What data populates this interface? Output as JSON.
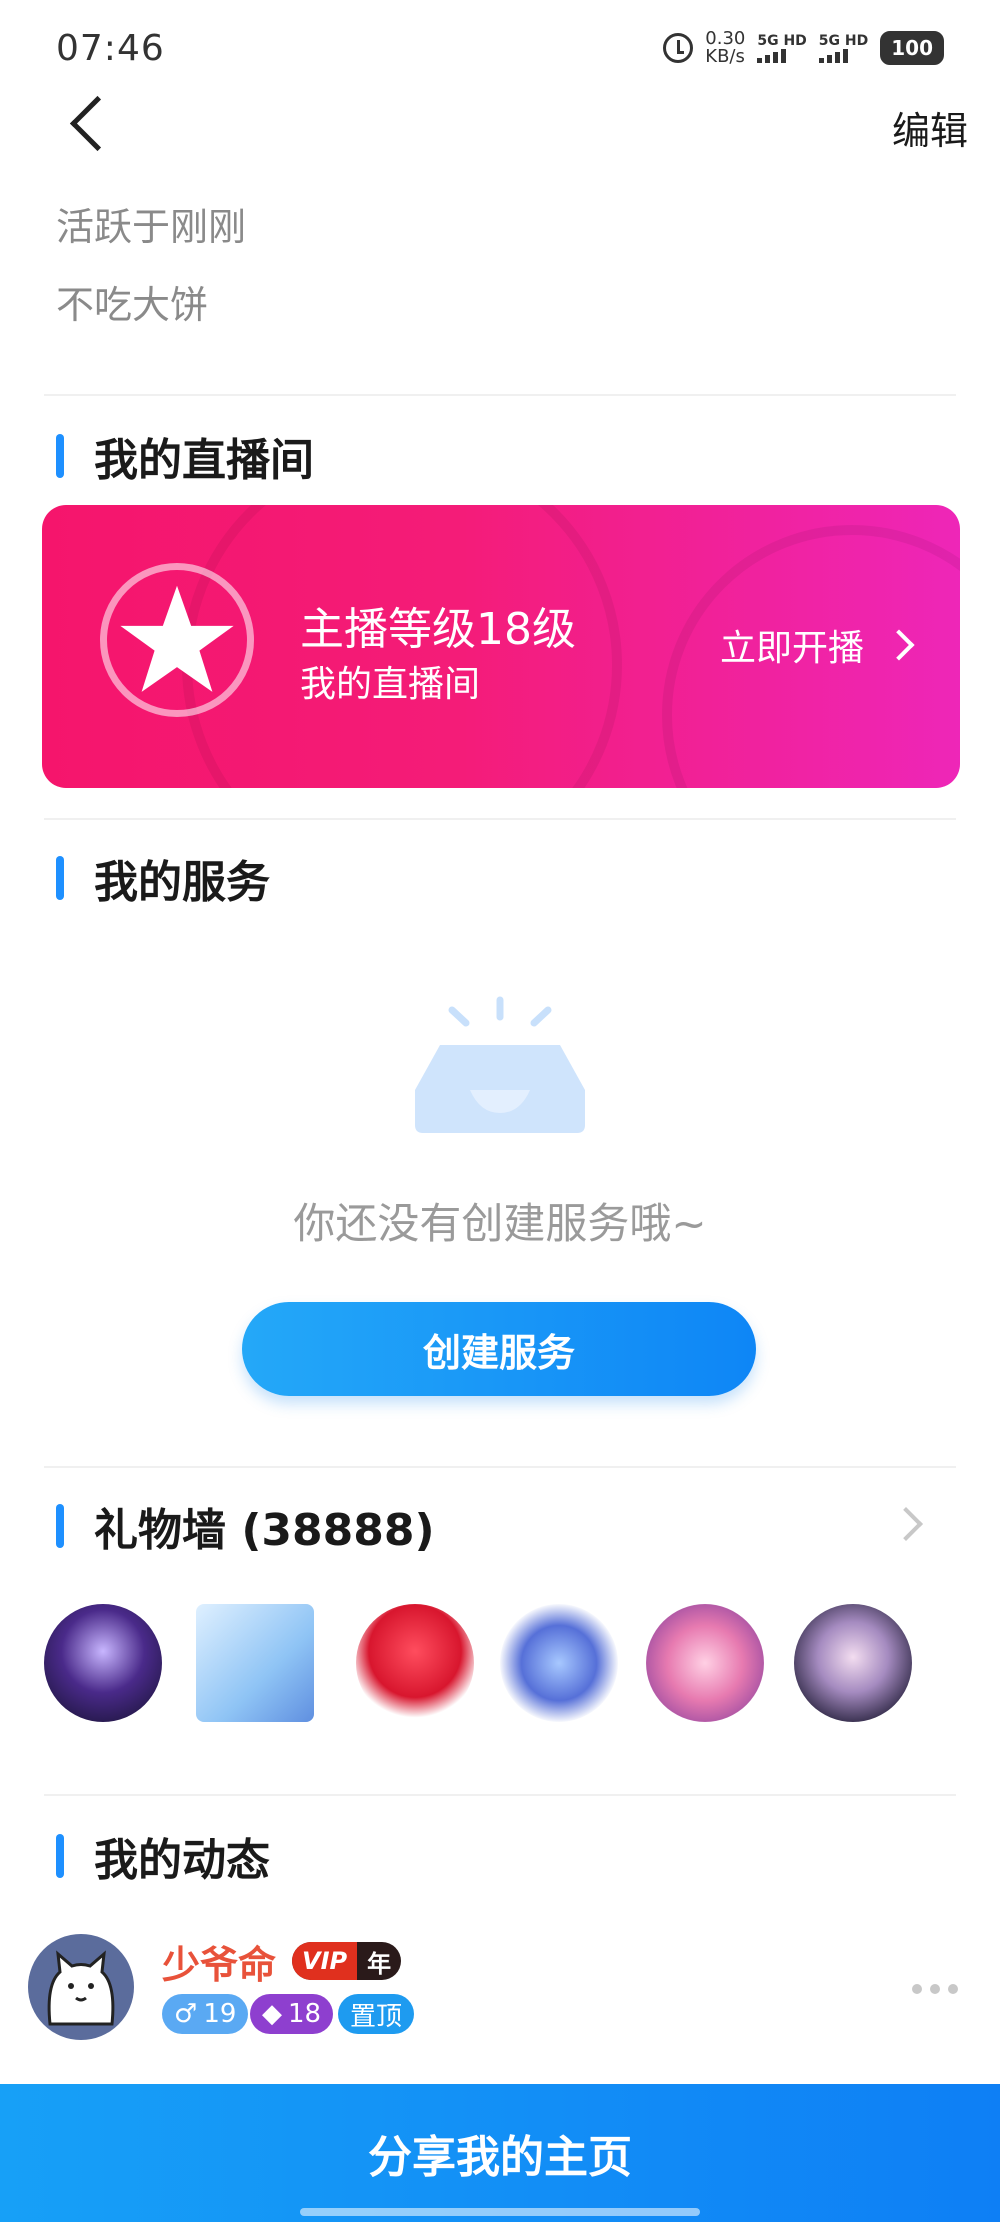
{
  "status_bar": {
    "time": "07:46",
    "speed_value": "0.30",
    "speed_unit": "KB/s",
    "sim1": "5G HD",
    "sim2": "5G HD",
    "battery": "100"
  },
  "header": {
    "edit_label": "编辑"
  },
  "profile": {
    "active_status": "活跃于刚刚",
    "signature": "不吃大饼"
  },
  "live_section": {
    "title": "我的直播间",
    "level_text": "主播等级18级",
    "room_label": "我的直播间",
    "start_label": "立即开播"
  },
  "services_section": {
    "title": "我的服务",
    "empty_text": "你还没有创建服务哦~",
    "create_button": "创建服务"
  },
  "gift_section": {
    "title": "礼物墙 (38888)",
    "gift_icons": [
      "lighthouse-gift",
      "astronaut-gift",
      "rose-heart-gift",
      "floating-castle-gift",
      "rose-gazebo-gift",
      "sky-castle-gift"
    ]
  },
  "moments_section": {
    "title": "我的动态",
    "post": {
      "username": "少爷命",
      "vip_label": "VIP",
      "vip_period": "年",
      "gender_age": "19",
      "level": "18",
      "pinned_label": "置顶"
    }
  },
  "bottom": {
    "share_label": "分享我的主页"
  },
  "colors": {
    "accent_blue": "#1e90ff",
    "live_card_start": "#f5156c",
    "live_card_end": "#ee26b8",
    "username": "#e8523a"
  }
}
